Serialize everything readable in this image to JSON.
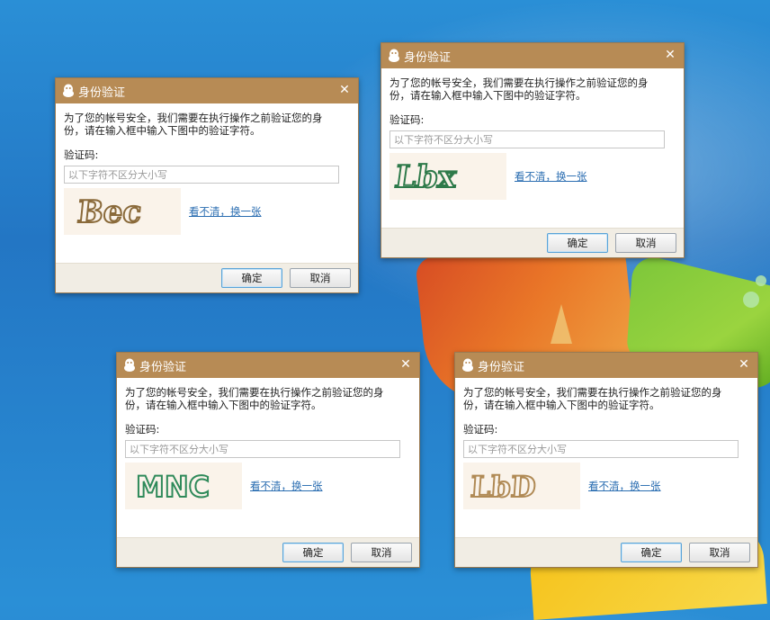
{
  "wallpaper": {
    "accent_orange": "#f3761f",
    "accent_green": "#7cc63a",
    "sky": "#2a8fd6"
  },
  "colors": {
    "titlebar": "#b78b55",
    "link": "#2a6db1",
    "footer": "#f1ede4"
  },
  "dialogs": [
    {
      "title": "身份验证",
      "close": "✕",
      "desc_line1": "为了您的帐号安全，我们需要在执行操作之前验证您的身",
      "desc_line2": "份，请在输入框中输入下图中的验证字符。",
      "field_label": "验证码:",
      "placeholder": "以下字符不区分大小写",
      "captcha_text": "Bec",
      "captcha_color": "#8a6a3a",
      "refresh": "看不清，换一张",
      "ok": "确定",
      "cancel": "取消"
    },
    {
      "title": "身份验证",
      "close": "✕",
      "desc_line1": "为了您的帐号安全，我们需要在执行操作之前验证您的身",
      "desc_line2": "份，请在输入框中输入下图中的验证字符。",
      "field_label": "验证码:",
      "placeholder": "以下字符不区分大小写",
      "captcha_text": "Lbx",
      "captcha_color": "#2e7a4a",
      "refresh": "看不清，换一张",
      "ok": "确定",
      "cancel": "取消"
    },
    {
      "title": "身份验证",
      "close": "✕",
      "desc_line1": "为了您的帐号安全，我们需要在执行操作之前验证您的身",
      "desc_line2": "份，请在输入框中输入下图中的验证字符。",
      "field_label": "验证码:",
      "placeholder": "以下字符不区分大小写",
      "captcha_text": "MNC",
      "captcha_color": "#2f8a5a",
      "refresh": "看不清，换一张",
      "ok": "确定",
      "cancel": "取消"
    },
    {
      "title": "身份验证",
      "close": "✕",
      "desc_line1": "为了您的帐号安全，我们需要在执行操作之前验证您的身",
      "desc_line2": "份，请在输入框中输入下图中的验证字符。",
      "field_label": "验证码:",
      "placeholder": "以下字符不区分大小写",
      "captcha_text": "LbD",
      "captcha_color": "#b08a55",
      "refresh": "看不清，换一张",
      "ok": "确定",
      "cancel": "取消"
    }
  ]
}
